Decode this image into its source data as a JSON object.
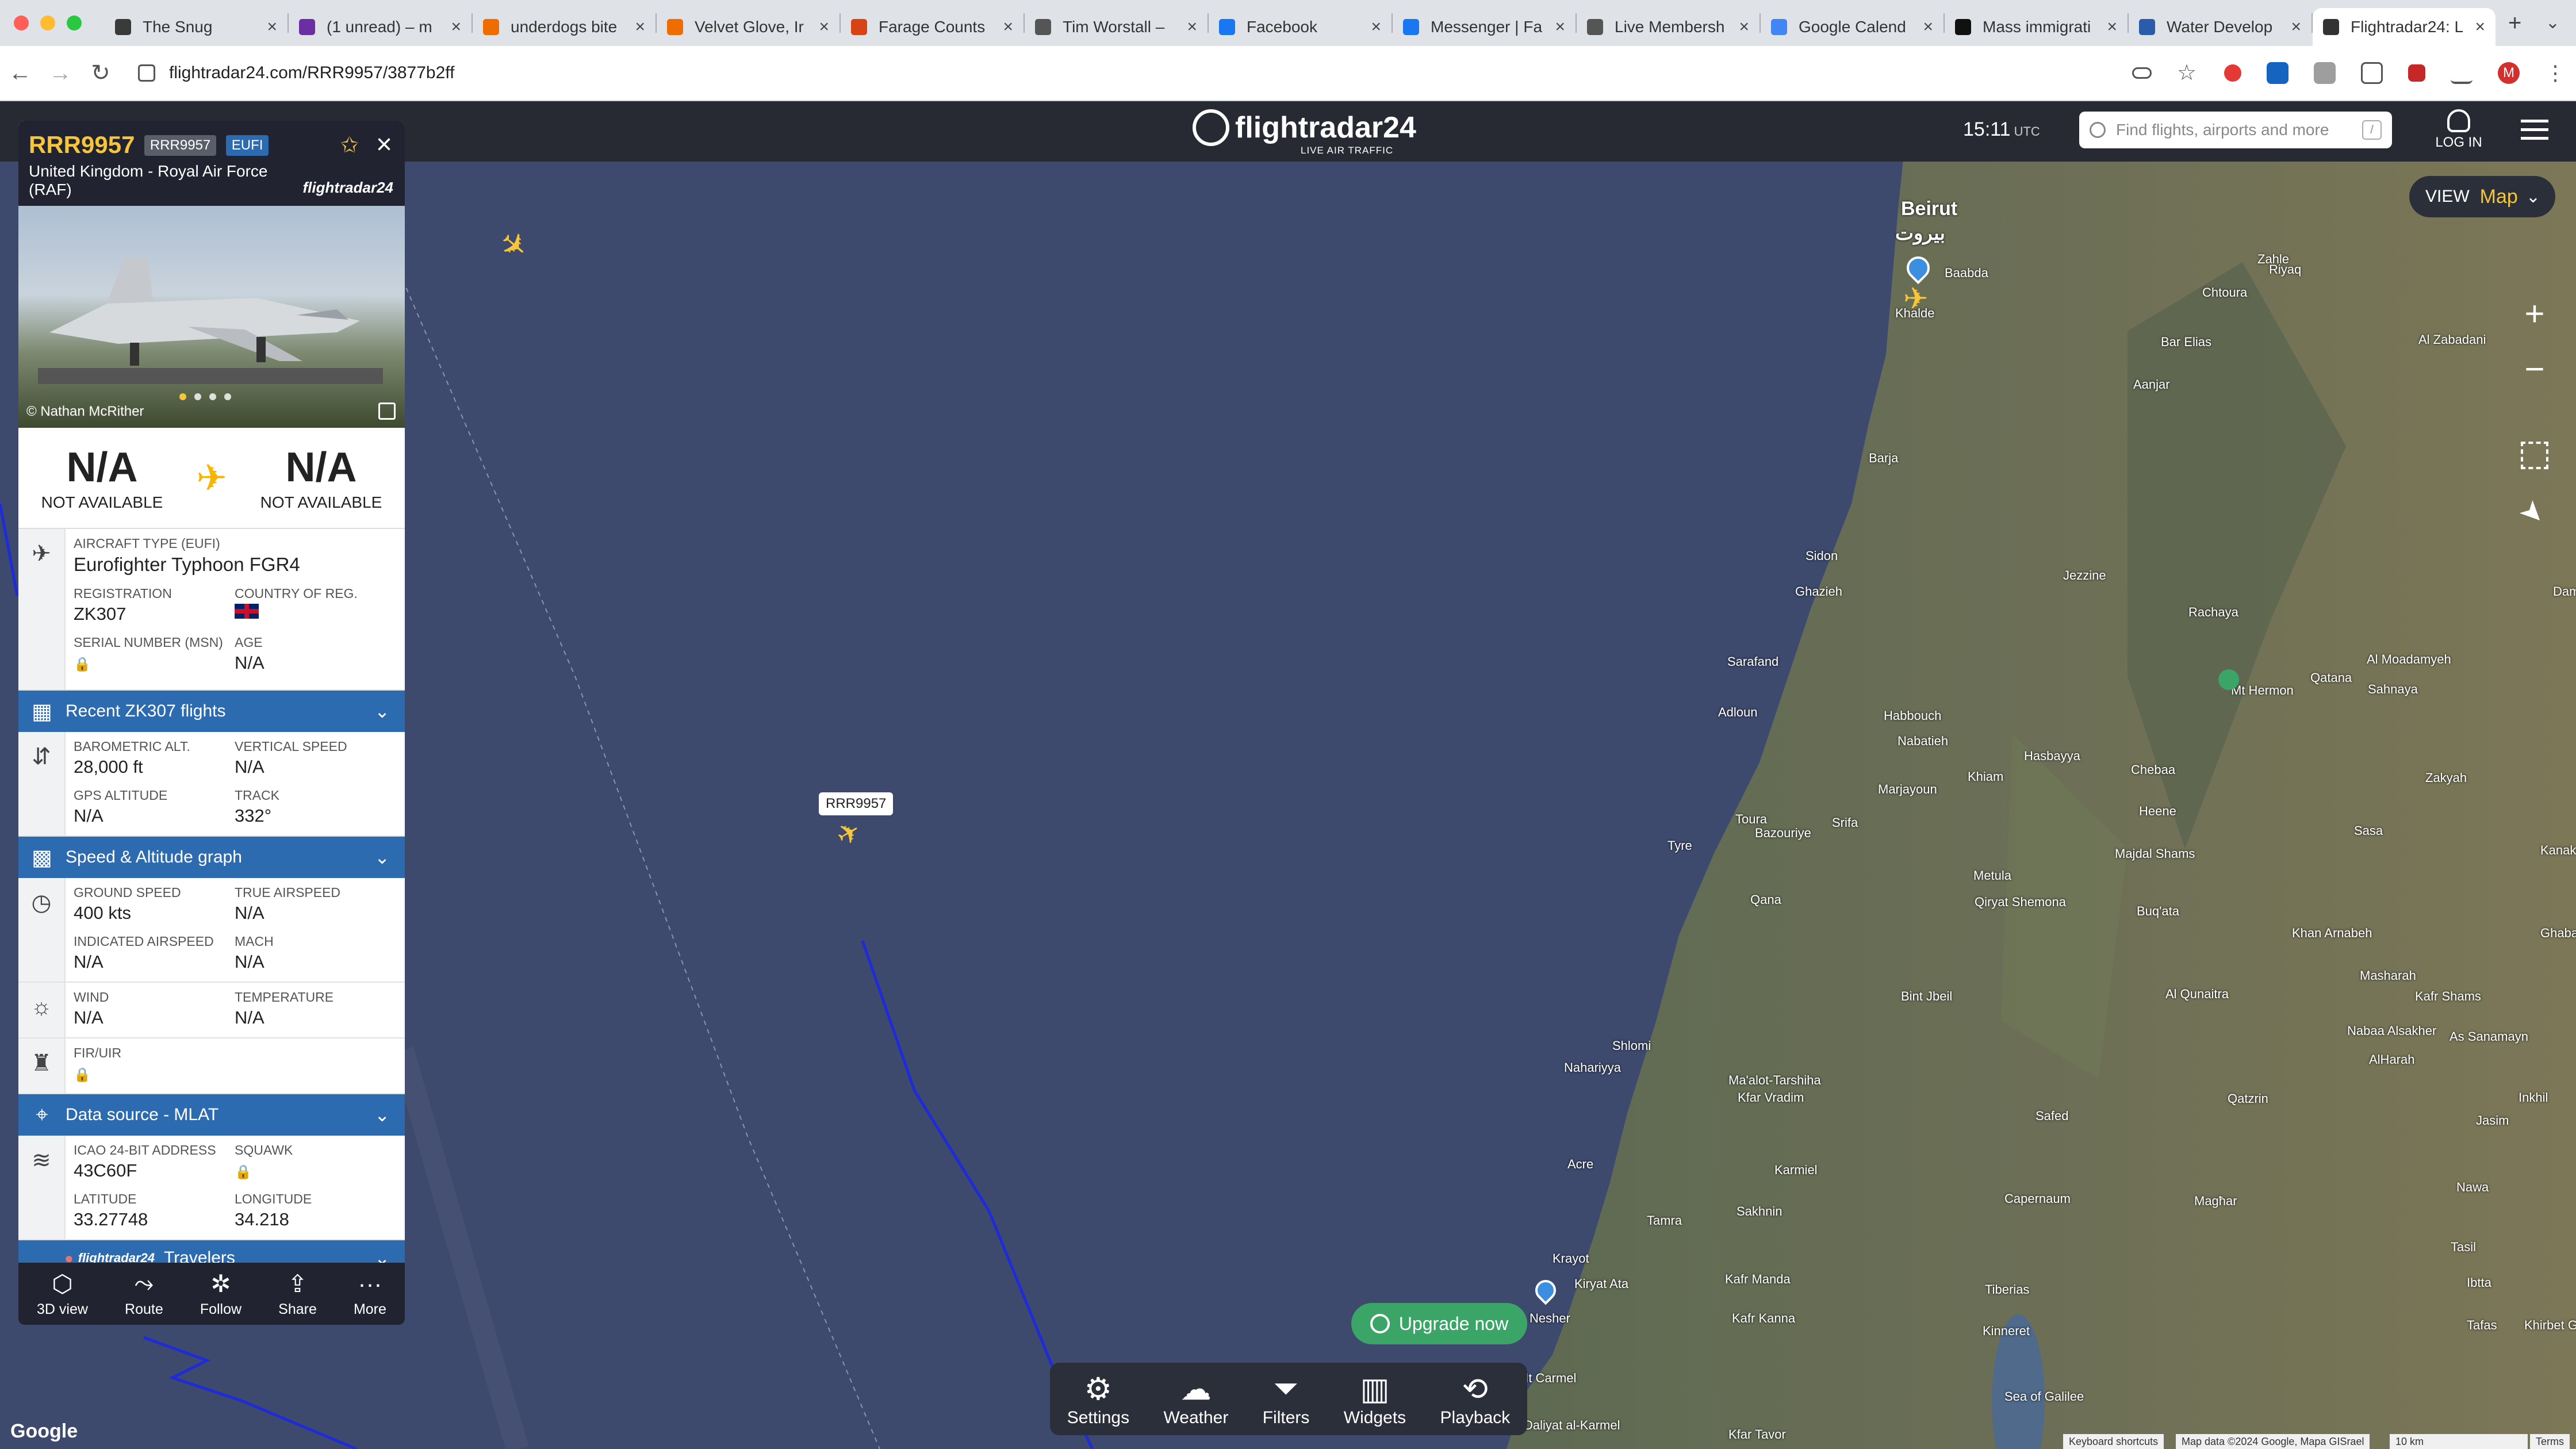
{
  "browser": {
    "tabs": [
      {
        "label": "The Snug",
        "color": "#3a3a3a"
      },
      {
        "label": "(1 unread) – m",
        "color": "#6b2ea3"
      },
      {
        "label": "underdogs bite",
        "color": "#ef6c00"
      },
      {
        "label": "Velvet Glove, Ir",
        "color": "#ef6c00"
      },
      {
        "label": "Farage Counts",
        "color": "#d84315"
      },
      {
        "label": "Tim Worstall – ",
        "color": "#555"
      },
      {
        "label": "Facebook",
        "color": "#1877f2"
      },
      {
        "label": "Messenger | Fa",
        "color": "#1877f2"
      },
      {
        "label": "Live Membersh",
        "color": "#555"
      },
      {
        "label": "Google Calend",
        "color": "#4285f4"
      },
      {
        "label": "Mass immigrati",
        "color": "#111"
      },
      {
        "label": "Water Develop",
        "color": "#2a5caa"
      },
      {
        "label": "Flightradar24: L",
        "color": "#333",
        "active": true
      }
    ],
    "url": "flightradar24.com/RRR9957/3877b2ff"
  },
  "header": {
    "logo_name": "flightradar24",
    "logo_sub": "LIVE AIR TRAFFIC",
    "time": "15:11",
    "time_zone": "UTC",
    "search_placeholder": "Find flights, airports and more",
    "search_key": "/",
    "login": "LOG IN"
  },
  "panel": {
    "callsign": "RRR9957",
    "badge_callsign": "RRR9957",
    "badge_type": "EUFI",
    "airline": "United Kingdom - Royal Air Force (RAF)",
    "brand": "flightradar24",
    "photo_credit": "© Nathan McRither",
    "origin_code": "N/A",
    "origin_status": "NOT AVAILABLE",
    "dest_code": "N/A",
    "dest_status": "NOT AVAILABLE",
    "aircraft_type_label": "AIRCRAFT TYPE (EUFI)",
    "aircraft_type": "Eurofighter Typhoon FGR4",
    "registration_label": "REGISTRATION",
    "registration": "ZK307",
    "country_label": "COUNTRY OF REG.",
    "serial_label": "SERIAL NUMBER (MSN)",
    "age_label": "AGE",
    "age": "N/A",
    "recent_flights": "Recent ZK307 flights",
    "baro_alt_label": "BAROMETRIC ALT.",
    "baro_alt": "28,000 ft",
    "vert_speed_label": "VERTICAL SPEED",
    "vert_speed": "N/A",
    "gps_alt_label": "GPS ALTITUDE",
    "gps_alt": "N/A",
    "track_label": "TRACK",
    "track": "332°",
    "speed_graph": "Speed & Altitude graph",
    "ground_speed_label": "GROUND SPEED",
    "ground_speed": "400 kts",
    "true_airspeed_label": "TRUE AIRSPEED",
    "true_airspeed": "N/A",
    "ias_label": "INDICATED AIRSPEED",
    "ias": "N/A",
    "mach_label": "MACH",
    "mach": "N/A",
    "wind_label": "WIND",
    "wind": "N/A",
    "temp_label": "TEMPERATURE",
    "temp": "N/A",
    "fir_label": "FIR/UIR",
    "data_source": "Data source - MLAT",
    "icao_label": "ICAO 24-BIT ADDRESS",
    "icao": "43C60F",
    "squawk_label": "SQUAWK",
    "lat_label": "LATITUDE",
    "lat": "33.27748",
    "lon_label": "LONGITUDE",
    "lon": "34.218",
    "travelers": "Travelers",
    "travelers_brand": "flightradar24",
    "actions": [
      "3D view",
      "Route",
      "Follow",
      "Share",
      "More"
    ]
  },
  "map": {
    "view_label": "VIEW",
    "view_value": "Map",
    "flight_label": "RRR9957",
    "upgrade": "Upgrade now",
    "bottom_tools": [
      "Settings",
      "Weather",
      "Filters",
      "Widgets",
      "Playback"
    ],
    "places": [
      {
        "name": "Beirut",
        "big": true
      },
      {
        "name": "بيروت",
        "big": true
      },
      {
        "name": "Baabda"
      },
      {
        "name": "Khalde"
      },
      {
        "name": "Zahle"
      },
      {
        "name": "Riyaq"
      },
      {
        "name": "Chtoura"
      },
      {
        "name": "Bar Elias"
      },
      {
        "name": "Al Zabadani"
      },
      {
        "name": "Aanjar"
      },
      {
        "name": "Barja"
      },
      {
        "name": "Sidon"
      },
      {
        "name": "Jezzine"
      },
      {
        "name": "Ghazieh"
      },
      {
        "name": "Rachaya"
      },
      {
        "name": "Sarafand"
      },
      {
        "name": "Adloun"
      },
      {
        "name": "Habbouch"
      },
      {
        "name": "Nabatieh"
      },
      {
        "name": "Marjayoun"
      },
      {
        "name": "Hasbayya"
      },
      {
        "name": "Mt Hermon"
      },
      {
        "name": "Qatana"
      },
      {
        "name": "Sahnaya"
      },
      {
        "name": "Al Moadamyeh"
      },
      {
        "name": "Dam"
      },
      {
        "name": "Khiam"
      },
      {
        "name": "Chebaa"
      },
      {
        "name": "Heene"
      },
      {
        "name": "Zakyah"
      },
      {
        "name": "Toura"
      },
      {
        "name": "Srifa"
      },
      {
        "name": "Tyre"
      },
      {
        "name": "Bazouriye"
      },
      {
        "name": "Metula"
      },
      {
        "name": "Majdal Shams"
      },
      {
        "name": "Sasa"
      },
      {
        "name": "Kanaker"
      },
      {
        "name": "Qana"
      },
      {
        "name": "Qiryat Shemona"
      },
      {
        "name": "Buq'ata"
      },
      {
        "name": "Khan Arnabeh"
      },
      {
        "name": "Ghabaghеb"
      },
      {
        "name": "Bint Jbeil"
      },
      {
        "name": "Al Qunaitra"
      },
      {
        "name": "Masharah"
      },
      {
        "name": "Kafr Shams"
      },
      {
        "name": "Shlomi"
      },
      {
        "name": "Nabaa Alsakher"
      },
      {
        "name": "As Sanamayn"
      },
      {
        "name": "Nahariyya"
      },
      {
        "name": "Ma'alot-Tarshiha"
      },
      {
        "name": "Kfar Vradim"
      },
      {
        "name": "AlHarah"
      },
      {
        "name": "Inkhil"
      },
      {
        "name": "Qatzrin"
      },
      {
        "name": "Safed"
      },
      {
        "name": "Jasim"
      },
      {
        "name": "Acre"
      },
      {
        "name": "Karmiel"
      },
      {
        "name": "Nawa"
      },
      {
        "name": "Magħar"
      },
      {
        "name": "Sakhnin"
      },
      {
        "name": "Tamra"
      },
      {
        "name": "Capernaum"
      },
      {
        "name": "Tasil"
      },
      {
        "name": "Krayot"
      },
      {
        "name": "Kiryat Ata"
      },
      {
        "name": "Kafr Manda"
      },
      {
        "name": "Tiberias"
      },
      {
        "name": "Sea of Galilee"
      },
      {
        "name": "Ibtta"
      },
      {
        "name": "Nesher"
      },
      {
        "name": "Kafr Kanna"
      },
      {
        "name": "Kinneret"
      },
      {
        "name": "Tafas"
      },
      {
        "name": "Khirbet Ghazaleh"
      },
      {
        "name": "Mt Carmel"
      },
      {
        "name": "Daliyat al-Karmel"
      },
      {
        "name": "Kfar Tavor"
      }
    ],
    "attribution_shortcuts": "Keyboard shortcuts",
    "attribution_data": "Map data ©2024 Google, Mapa GISrael",
    "attribution_scale": "10 km",
    "attribution_terms": "Terms",
    "google_logo": "Google"
  }
}
